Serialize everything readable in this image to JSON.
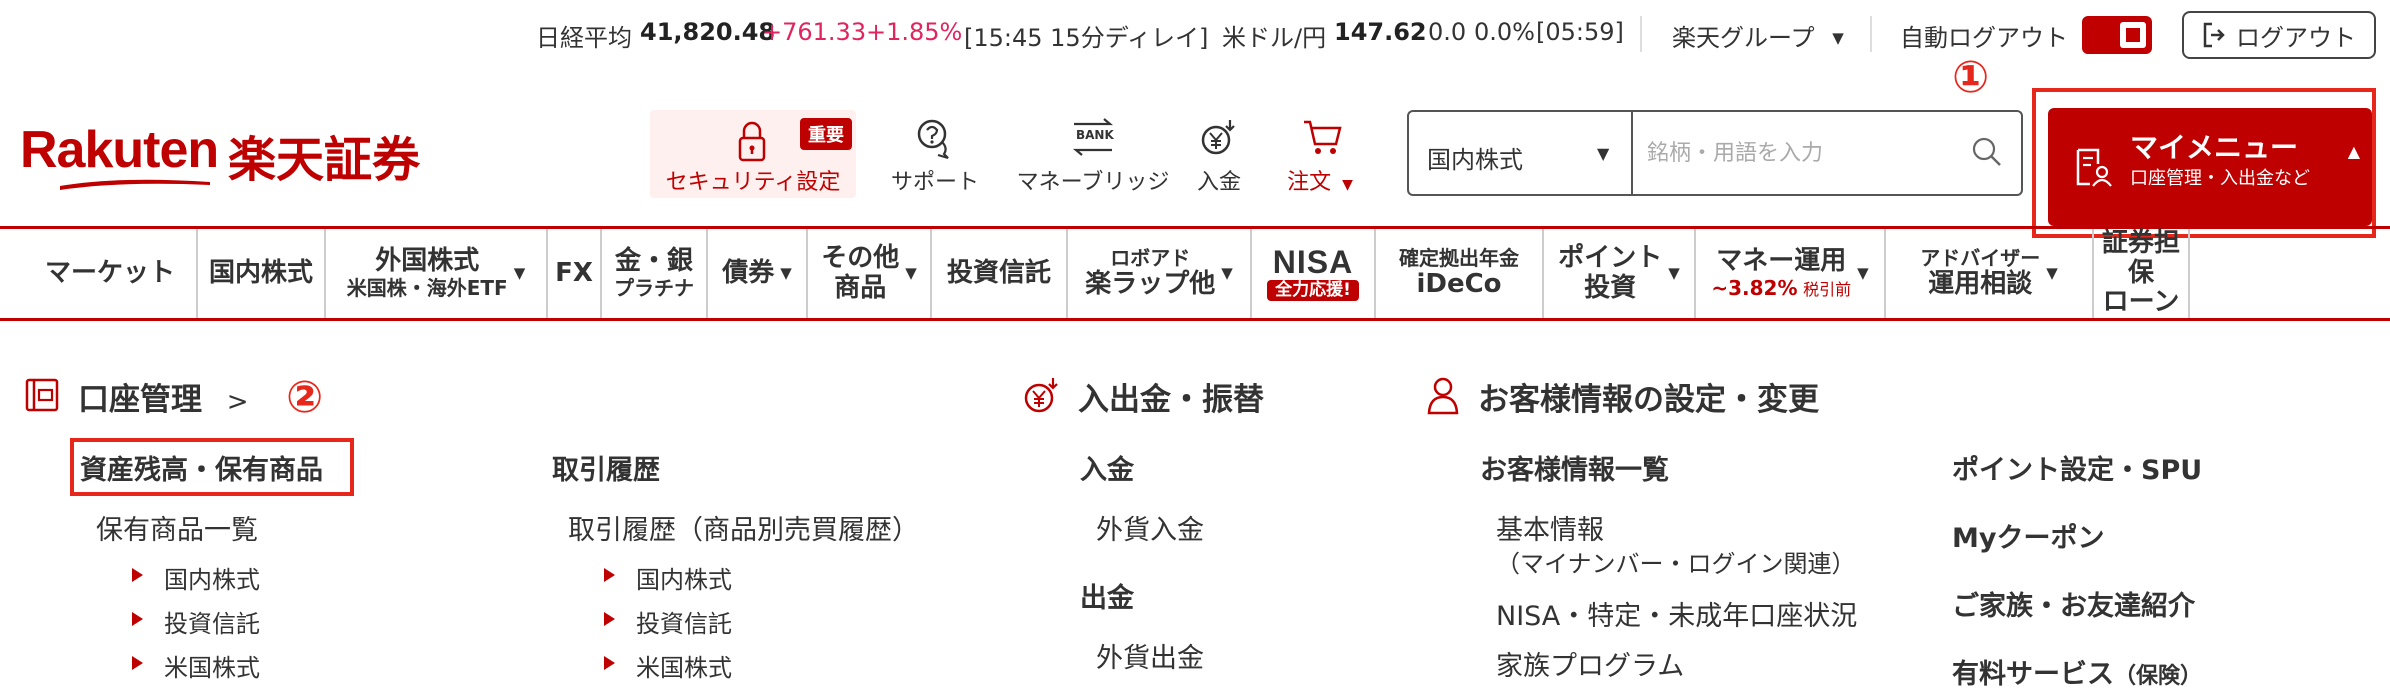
{
  "ticker": {
    "nikkei_label": "日経平均",
    "nikkei_value": "41,820.48",
    "nikkei_change": "+761.33",
    "nikkei_pct": "+1.85%",
    "nikkei_time": "[15:45 15分ディレイ]",
    "usd_label": "米ドル/円",
    "usd_value": "147.62",
    "usd_change": "0.0",
    "usd_pct": "0.0%",
    "usd_time": "[05:59]",
    "group_label": "楽天グループ",
    "auto_logout_label": "自動ログアウト",
    "logout_label": "ログアウト"
  },
  "logo": {
    "word": "Rakuten",
    "jp": "楽天証券"
  },
  "header_nav": {
    "security": "セキュリティ設定",
    "important_badge": "重要",
    "support": "サポート",
    "bank_icon_text": "BANK",
    "money_bridge": "マネーブリッジ",
    "deposit": "入金",
    "order": "注文"
  },
  "search": {
    "category": "国内株式",
    "placeholder": "銘柄・用語を入力"
  },
  "mymenu": {
    "title": "マイメニュー",
    "subtitle": "口座管理・入出金など"
  },
  "annotations": {
    "one": "①",
    "two": "②"
  },
  "gnav": {
    "market": "マーケット",
    "domestic": "国内株式",
    "foreign_l1": "外国株式",
    "foreign_l2": "米国株・海外ETF",
    "fx": "FX",
    "gold_l1": "金・銀",
    "gold_l2": "プラチナ",
    "bonds": "債券",
    "other_l1": "その他",
    "other_l2": "商品",
    "funds": "投資信託",
    "robo_l1": "ロボアド",
    "robo_l2": "楽ラップ他",
    "nisa": "NISA",
    "nisa_badge": "全力応援!",
    "ideco_l1": "確定拠出年金",
    "ideco_l2": "iDeCo",
    "point_l1": "ポイント",
    "point_l2": "投資",
    "money_l1": "マネー運用",
    "money_rate": "~3.82%",
    "money_tax": "税引前",
    "advisor_l1": "アドバイザー",
    "advisor_l2": "運用相談",
    "loan_l1": "証券担保",
    "loan_l2": "ローン"
  },
  "menu": {
    "account": {
      "title": "口座管理",
      "chevron": ">",
      "assets_head": "資産残高・保有商品",
      "holdings": "保有商品一覧",
      "holdings_sub": [
        "国内株式",
        "投資信託",
        "米国株式"
      ],
      "history_head": "取引履歴",
      "history": "取引履歴（商品別売買履歴）",
      "history_sub": [
        "国内株式",
        "投資信託",
        "米国株式"
      ]
    },
    "transfer": {
      "title": "入出金・振替",
      "deposit_head": "入金",
      "fx_deposit": "外貨入金",
      "withdraw_head": "出金",
      "fx_withdraw": "外貨出金"
    },
    "customer": {
      "title": "お客様情報の設定・変更",
      "list_head": "お客様情報一覧",
      "basic": "基本情報",
      "basic_note": "（マイナンバー・ログイン関連）",
      "nisa_status": "NISA・特定・未成年口座状況",
      "family": "家族プログラム",
      "points_spu": "ポイント設定・SPU",
      "coupon": "Myクーポン",
      "referral": "ご家族・お友達紹介",
      "paid": "有料サービス",
      "paid_note": "（保険）"
    }
  }
}
